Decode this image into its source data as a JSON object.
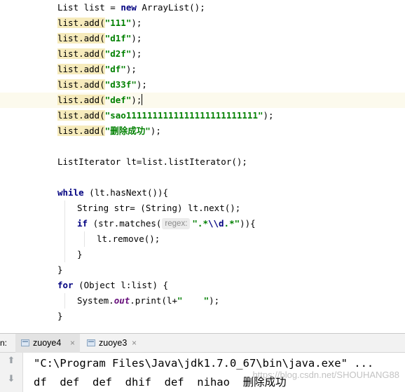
{
  "editor": {
    "current_line_index": 6,
    "lines": [
      {
        "indent": 0,
        "hl": false,
        "segments": [
          {
            "t": "List list = "
          },
          {
            "t": "new",
            "c": "kw"
          },
          {
            "t": " ArrayList();"
          }
        ]
      },
      {
        "indent": 0,
        "hl": true,
        "segments": [
          {
            "t": "list.add("
          },
          {
            "t": "\"111\"",
            "c": "str"
          },
          {
            "t": ");"
          }
        ]
      },
      {
        "indent": 0,
        "hl": true,
        "segments": [
          {
            "t": "list.add("
          },
          {
            "t": "\"d1f\"",
            "c": "str"
          },
          {
            "t": ");"
          }
        ]
      },
      {
        "indent": 0,
        "hl": true,
        "segments": [
          {
            "t": "list.add("
          },
          {
            "t": "\"d2f\"",
            "c": "str"
          },
          {
            "t": ");"
          }
        ]
      },
      {
        "indent": 0,
        "hl": true,
        "segments": [
          {
            "t": "list.add("
          },
          {
            "t": "\"df\"",
            "c": "str"
          },
          {
            "t": ");"
          }
        ]
      },
      {
        "indent": 0,
        "hl": true,
        "segments": [
          {
            "t": "list.add("
          },
          {
            "t": "\"d33f\"",
            "c": "str"
          },
          {
            "t": ");"
          }
        ]
      },
      {
        "indent": 0,
        "hl": true,
        "segments": [
          {
            "t": "list.add("
          },
          {
            "t": "\"def\"",
            "c": "str"
          },
          {
            "t": ");"
          }
        ],
        "caret": true
      },
      {
        "indent": 0,
        "hl": true,
        "segments": [
          {
            "t": "list.add("
          },
          {
            "t": "\"sao1111111111111111111111111\"",
            "c": "str"
          },
          {
            "t": ");"
          }
        ]
      },
      {
        "indent": 0,
        "hl": true,
        "segments": [
          {
            "t": "list.add("
          },
          {
            "t": "\"删除成功\"",
            "c": "str"
          },
          {
            "t": ");"
          }
        ]
      },
      {
        "indent": 0,
        "hl": false,
        "segments": []
      },
      {
        "indent": 0,
        "hl": false,
        "segments": [
          {
            "t": "ListIterator lt=list.listIterator();"
          }
        ]
      },
      {
        "indent": 0,
        "hl": false,
        "segments": []
      },
      {
        "indent": 0,
        "hl": false,
        "segments": [
          {
            "t": "while",
            "c": "kw"
          },
          {
            "t": " (lt.hasNext()){"
          }
        ]
      },
      {
        "indent": 1,
        "hl": false,
        "segments": [
          {
            "t": "String str= (String) lt.next();"
          }
        ]
      },
      {
        "indent": 1,
        "hl": false,
        "segments": [
          {
            "t": "if",
            "c": "kw"
          },
          {
            "t": " (str.matches("
          },
          {
            "hint": "regex:"
          },
          {
            "t": "\".*",
            "c": "str"
          },
          {
            "t": "\\\\d",
            "c": "esc"
          },
          {
            "t": ".*\"",
            "c": "str"
          },
          {
            "t": ")){"
          }
        ]
      },
      {
        "indent": 2,
        "hl": false,
        "segments": [
          {
            "t": "lt.remove();"
          }
        ]
      },
      {
        "indent": 1,
        "hl": false,
        "segments": [
          {
            "t": "}"
          }
        ]
      },
      {
        "indent": 0,
        "hl": false,
        "segments": [
          {
            "t": "}"
          }
        ]
      },
      {
        "indent": 0,
        "hl": false,
        "segments": [
          {
            "t": "for",
            "c": "kw"
          },
          {
            "t": " (Object l:list) {"
          }
        ]
      },
      {
        "indent": 1,
        "hl": false,
        "segments": [
          {
            "t": "System."
          },
          {
            "t": "out",
            "c": "fld"
          },
          {
            "t": ".print(l+"
          },
          {
            "t": "\"    \"",
            "c": "str"
          },
          {
            "t": ");"
          }
        ]
      },
      {
        "indent": 0,
        "hl": false,
        "segments": [
          {
            "t": "}"
          }
        ]
      }
    ]
  },
  "run_panel": {
    "label": "n:",
    "tabs": [
      {
        "name": "zuoye4",
        "close": "×"
      },
      {
        "name": "zuoye3",
        "close": "×"
      }
    ],
    "gutter_icons": [
      "arrow-up-icon",
      "arrow-down-icon"
    ],
    "console_lines": [
      "\"C:\\Program Files\\Java\\jdk1.7.0_67\\bin\\java.exe\" ...",
      "df  def  def  dhif  def  nihao  删除成功"
    ]
  },
  "watermark": "https://blog.csdn.net/SHOUHANG88"
}
